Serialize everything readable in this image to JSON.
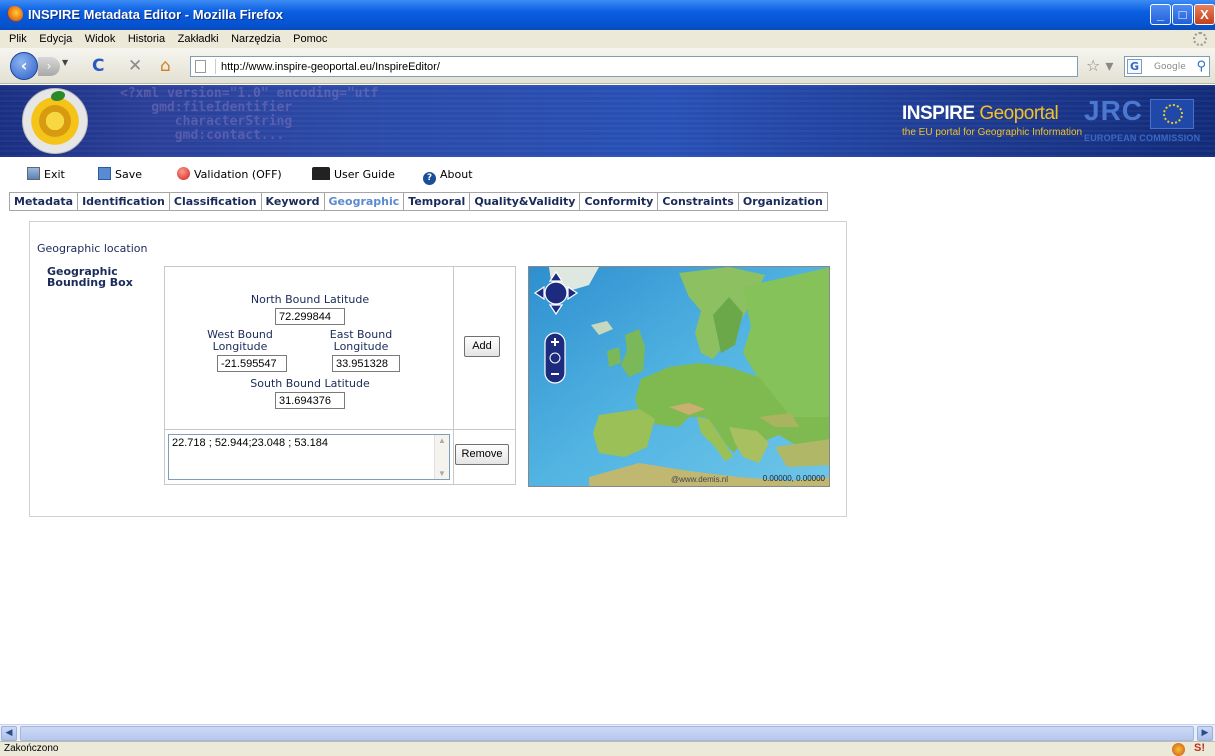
{
  "window": {
    "title": "INSPIRE Metadata Editor - Mozilla Firefox",
    "minimize": "_",
    "maximize": "□",
    "close": "X"
  },
  "menu": [
    "Plik",
    "Edycja",
    "Widok",
    "Historia",
    "Zakładki",
    "Narzędzia",
    "Pomoc"
  ],
  "nav": {
    "url": "http://www.inspire-geoportal.eu/InspireEditor/",
    "search_placeholder": "Google"
  },
  "banner": {
    "title_inspire": "INSPIRE",
    "title_geo": "Geoportal",
    "subtitle": "the EU portal for Geographic Information",
    "jrc": "JRC",
    "ec": "EUROPEAN COMMISSION",
    "ghost": "<?xml version=\"1.0\" encoding=\"utf\n    gmd:fileIdentifier\n       characterString\n       gmd:contact..."
  },
  "toolbar": {
    "exit": "Exit",
    "save": "Save",
    "validation": "Validation (OFF)",
    "user_guide": "User Guide",
    "about": "About"
  },
  "tabs": [
    {
      "label": "Metadata",
      "active": false
    },
    {
      "label": "Identification",
      "active": false
    },
    {
      "label": "Classification",
      "active": false
    },
    {
      "label": "Keyword",
      "active": false
    },
    {
      "label": "Geographic",
      "active": true
    },
    {
      "label": "Temporal",
      "active": false
    },
    {
      "label": "Quality&Validity",
      "active": false
    },
    {
      "label": "Conformity",
      "active": false
    },
    {
      "label": "Constraints",
      "active": false
    },
    {
      "label": "Organization",
      "active": false
    }
  ],
  "geographic": {
    "section": "Geographic location",
    "field": "Geographic Bounding Box",
    "north_label": "North Bound Latitude",
    "north_value": "72.299844",
    "west_label": "West Bound Longitude",
    "west_value": "-21.595547",
    "east_label": "East Bound Longitude",
    "east_value": "33.951328",
    "south_label": "South Bound Latitude",
    "south_value": "31.694376",
    "add_button": "Add",
    "list_value": "22.718 ; 52.944;23.048 ; 53.184",
    "remove_button": "Remove"
  },
  "map": {
    "credit": "@www.demis.nl",
    "coords": "0.00000, 0.00000"
  },
  "status": {
    "text": "Zakończono"
  },
  "colors": {
    "tab_active": "#5a8ad0",
    "tab_text": "#1a2a5a",
    "banner_bg": "#2850b6",
    "geoportal_yellow": "#f3c22a",
    "sea": "#3aa3d8",
    "land": "#7ec050"
  }
}
